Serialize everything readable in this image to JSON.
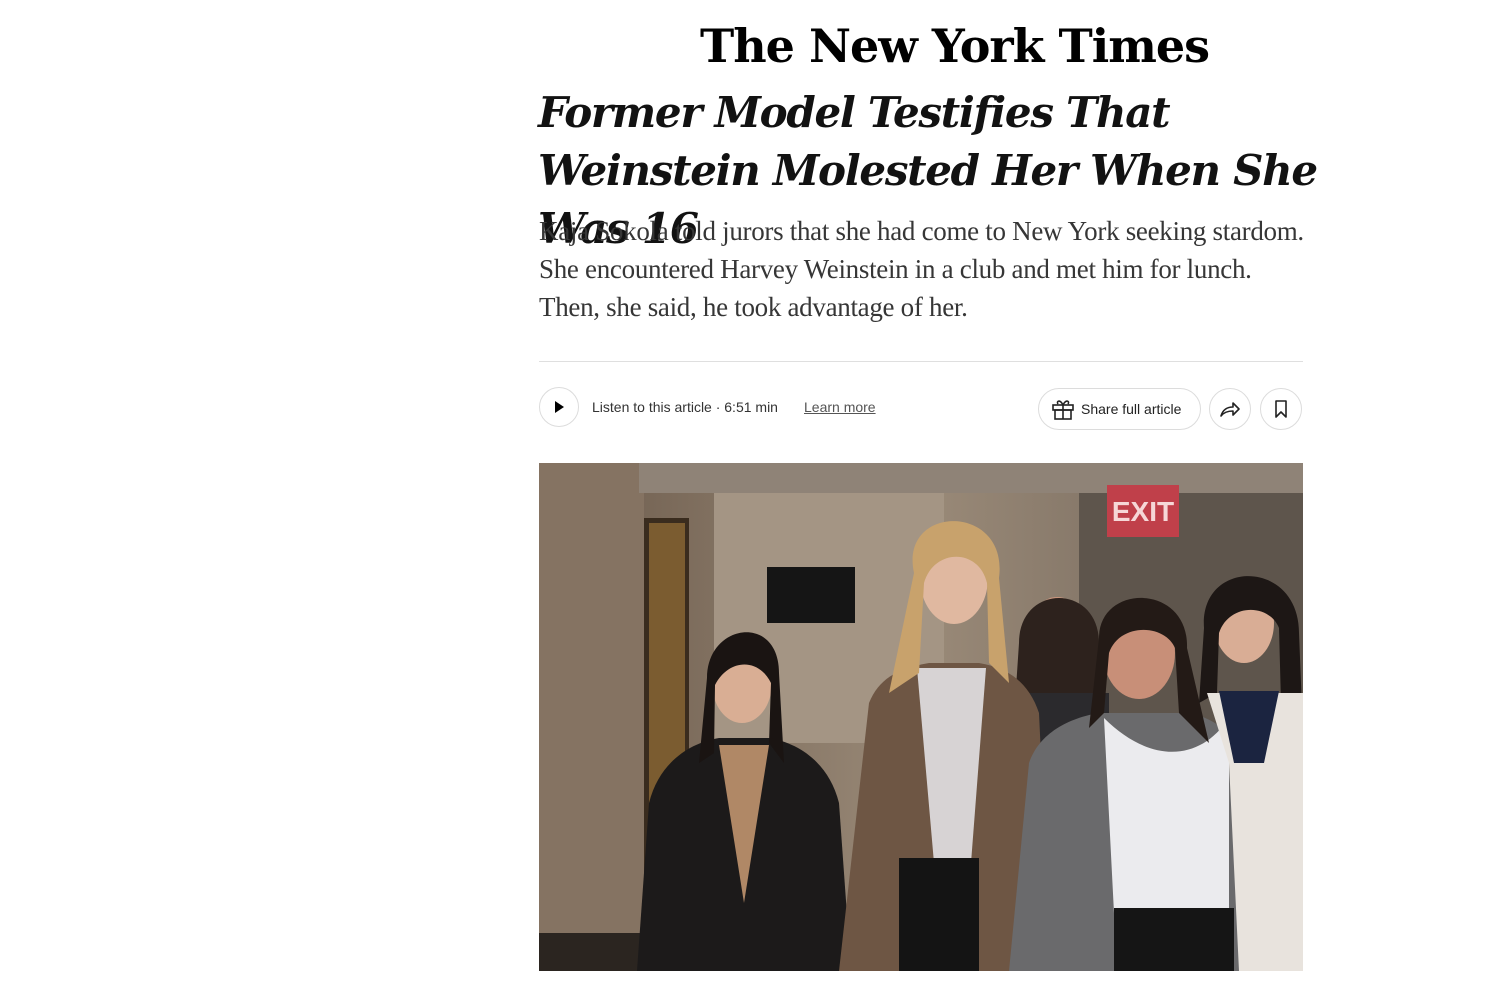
{
  "masthead": {
    "title": "The New York Times"
  },
  "article": {
    "headline": "Former Model Testifies That Weinstein Molested Her When She Was 16",
    "summary": "Kaja Sokola told jurors that she had come to New York seeking stardom. She encountered Harvey Weinstein in a club and met him for lunch. Then, she said, he took advantage of her."
  },
  "toolbar": {
    "play_icon": "play-icon",
    "listen_label": "Listen to this article · 6:51 min",
    "learn_more": "Learn more",
    "share_full_label": "Share full article",
    "gift_icon": "gift-icon",
    "share_icon": "share-arrow-icon",
    "bookmark_icon": "bookmark-icon"
  },
  "photo": {
    "sign_text": "EXIT",
    "description_icon": "photo"
  }
}
